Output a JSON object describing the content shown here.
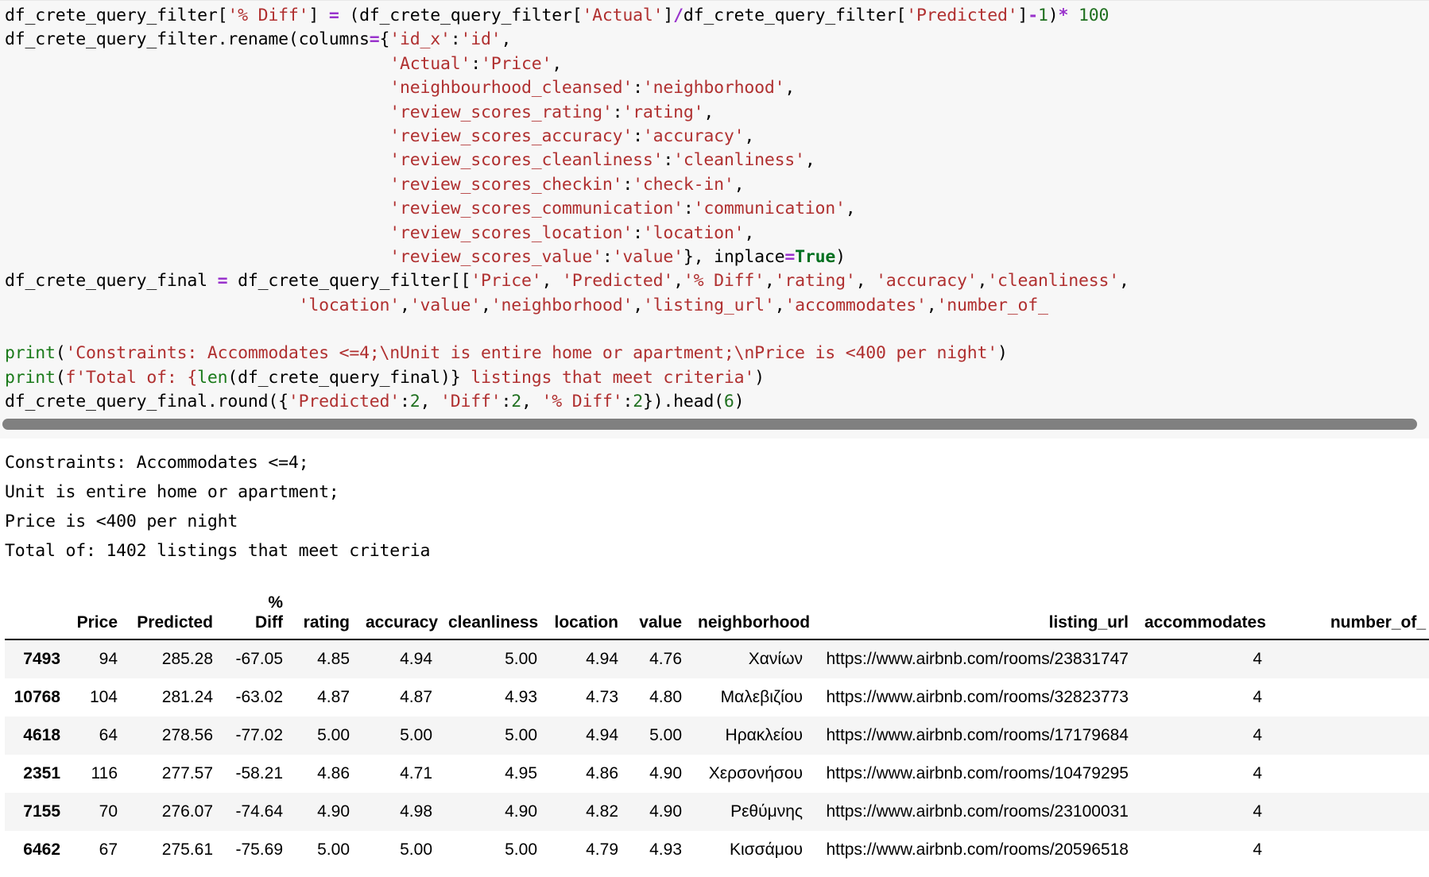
{
  "code_cell": {
    "lines": [
      [
        {
          "t": "df_crete_query_filter[",
          "c": "plain"
        },
        {
          "t": "'% Diff'",
          "c": "str"
        },
        {
          "t": "] ",
          "c": "plain"
        },
        {
          "t": "=",
          "c": "op"
        },
        {
          "t": " (df_crete_query_filter[",
          "c": "plain"
        },
        {
          "t": "'Actual'",
          "c": "str"
        },
        {
          "t": "]",
          "c": "plain"
        },
        {
          "t": "/",
          "c": "op"
        },
        {
          "t": "df_crete_query_filter[",
          "c": "plain"
        },
        {
          "t": "'Predicted'",
          "c": "str"
        },
        {
          "t": "]",
          "c": "plain"
        },
        {
          "t": "-",
          "c": "op"
        },
        {
          "t": "1",
          "c": "num"
        },
        {
          "t": ")",
          "c": "plain"
        },
        {
          "t": "*",
          "c": "op"
        },
        {
          "t": " ",
          "c": "plain"
        },
        {
          "t": "100",
          "c": "num"
        }
      ],
      [
        {
          "t": "df_crete_query_filter.rename(columns",
          "c": "plain"
        },
        {
          "t": "=",
          "c": "op"
        },
        {
          "t": "{",
          "c": "plain"
        },
        {
          "t": "'id_x'",
          "c": "str"
        },
        {
          "t": ":",
          "c": "plain"
        },
        {
          "t": "'id'",
          "c": "str"
        },
        {
          "t": ",",
          "c": "plain"
        }
      ],
      [
        {
          "t": "                                      ",
          "c": "plain"
        },
        {
          "t": "'Actual'",
          "c": "str"
        },
        {
          "t": ":",
          "c": "plain"
        },
        {
          "t": "'Price'",
          "c": "str"
        },
        {
          "t": ",",
          "c": "plain"
        }
      ],
      [
        {
          "t": "                                      ",
          "c": "plain"
        },
        {
          "t": "'neighbourhood_cleansed'",
          "c": "str"
        },
        {
          "t": ":",
          "c": "plain"
        },
        {
          "t": "'neighborhood'",
          "c": "str"
        },
        {
          "t": ",",
          "c": "plain"
        }
      ],
      [
        {
          "t": "                                      ",
          "c": "plain"
        },
        {
          "t": "'review_scores_rating'",
          "c": "str"
        },
        {
          "t": ":",
          "c": "plain"
        },
        {
          "t": "'rating'",
          "c": "str"
        },
        {
          "t": ",",
          "c": "plain"
        }
      ],
      [
        {
          "t": "                                      ",
          "c": "plain"
        },
        {
          "t": "'review_scores_accuracy'",
          "c": "str"
        },
        {
          "t": ":",
          "c": "plain"
        },
        {
          "t": "'accuracy'",
          "c": "str"
        },
        {
          "t": ",",
          "c": "plain"
        }
      ],
      [
        {
          "t": "                                      ",
          "c": "plain"
        },
        {
          "t": "'review_scores_cleanliness'",
          "c": "str"
        },
        {
          "t": ":",
          "c": "plain"
        },
        {
          "t": "'cleanliness'",
          "c": "str"
        },
        {
          "t": ",",
          "c": "plain"
        }
      ],
      [
        {
          "t": "                                      ",
          "c": "plain"
        },
        {
          "t": "'review_scores_checkin'",
          "c": "str"
        },
        {
          "t": ":",
          "c": "plain"
        },
        {
          "t": "'check-in'",
          "c": "str"
        },
        {
          "t": ",",
          "c": "plain"
        }
      ],
      [
        {
          "t": "                                      ",
          "c": "plain"
        },
        {
          "t": "'review_scores_communication'",
          "c": "str"
        },
        {
          "t": ":",
          "c": "plain"
        },
        {
          "t": "'communication'",
          "c": "str"
        },
        {
          "t": ",",
          "c": "plain"
        }
      ],
      [
        {
          "t": "                                      ",
          "c": "plain"
        },
        {
          "t": "'review_scores_location'",
          "c": "str"
        },
        {
          "t": ":",
          "c": "plain"
        },
        {
          "t": "'location'",
          "c": "str"
        },
        {
          "t": ",",
          "c": "plain"
        }
      ],
      [
        {
          "t": "                                      ",
          "c": "plain"
        },
        {
          "t": "'review_scores_value'",
          "c": "str"
        },
        {
          "t": ":",
          "c": "plain"
        },
        {
          "t": "'value'",
          "c": "str"
        },
        {
          "t": "}, inplace",
          "c": "plain"
        },
        {
          "t": "=",
          "c": "op"
        },
        {
          "t": "True",
          "c": "kw"
        },
        {
          "t": ")",
          "c": "plain"
        }
      ],
      [
        {
          "t": "df_crete_query_final ",
          "c": "plain"
        },
        {
          "t": "=",
          "c": "op"
        },
        {
          "t": " df_crete_query_filter[[",
          "c": "plain"
        },
        {
          "t": "'Price'",
          "c": "str"
        },
        {
          "t": ", ",
          "c": "plain"
        },
        {
          "t": "'Predicted'",
          "c": "str"
        },
        {
          "t": ",",
          "c": "plain"
        },
        {
          "t": "'% Diff'",
          "c": "str"
        },
        {
          "t": ",",
          "c": "plain"
        },
        {
          "t": "'rating'",
          "c": "str"
        },
        {
          "t": ", ",
          "c": "plain"
        },
        {
          "t": "'accuracy'",
          "c": "str"
        },
        {
          "t": ",",
          "c": "plain"
        },
        {
          "t": "'cleanliness'",
          "c": "str"
        },
        {
          "t": ",",
          "c": "plain"
        }
      ],
      [
        {
          "t": "                             ",
          "c": "plain"
        },
        {
          "t": "'location'",
          "c": "str"
        },
        {
          "t": ",",
          "c": "plain"
        },
        {
          "t": "'value'",
          "c": "str"
        },
        {
          "t": ",",
          "c": "plain"
        },
        {
          "t": "'neighborhood'",
          "c": "str"
        },
        {
          "t": ",",
          "c": "plain"
        },
        {
          "t": "'listing_url'",
          "c": "str"
        },
        {
          "t": ",",
          "c": "plain"
        },
        {
          "t": "'accommodates'",
          "c": "str"
        },
        {
          "t": ",",
          "c": "plain"
        },
        {
          "t": "'number_of_",
          "c": "str"
        }
      ],
      [],
      [
        {
          "t": "print",
          "c": "fn"
        },
        {
          "t": "(",
          "c": "plain"
        },
        {
          "t": "'Constraints: Accommodates <=4;\\nUnit is entire home or apartment;\\nPrice is <400 per night'",
          "c": "str"
        },
        {
          "t": ")",
          "c": "plain"
        }
      ],
      [
        {
          "t": "print",
          "c": "fn"
        },
        {
          "t": "(",
          "c": "plain"
        },
        {
          "t": "f'Total of: {",
          "c": "str"
        },
        {
          "t": "len",
          "c": "fn"
        },
        {
          "t": "(df_crete_query_final)} ",
          "c": "plain"
        },
        {
          "t": "listings that meet criteria'",
          "c": "str"
        },
        {
          "t": ")",
          "c": "plain"
        }
      ],
      [
        {
          "t": "df_crete_query_final.round({",
          "c": "plain"
        },
        {
          "t": "'Predicted'",
          "c": "str"
        },
        {
          "t": ":",
          "c": "plain"
        },
        {
          "t": "2",
          "c": "num"
        },
        {
          "t": ", ",
          "c": "plain"
        },
        {
          "t": "'Diff'",
          "c": "str"
        },
        {
          "t": ":",
          "c": "plain"
        },
        {
          "t": "2",
          "c": "num"
        },
        {
          "t": ", ",
          "c": "plain"
        },
        {
          "t": "'% Diff'",
          "c": "str"
        },
        {
          "t": ":",
          "c": "plain"
        },
        {
          "t": "2",
          "c": "num"
        },
        {
          "t": "}).head(",
          "c": "plain"
        },
        {
          "t": "6",
          "c": "num"
        },
        {
          "t": ")",
          "c": "plain"
        }
      ]
    ],
    "scrollbar": {
      "orientation": "horizontal"
    }
  },
  "stdout": "Constraints: Accommodates <=4;\nUnit is entire home or apartment;\nPrice is <400 per night\nTotal of: 1402 listings that meet criteria",
  "table_data": {
    "type": "table",
    "index_header": "",
    "columns": [
      "Price",
      "Predicted",
      "%\nDiff",
      "rating",
      "accuracy",
      "cleanliness",
      "location",
      "value",
      "neighborhood",
      "listing_url",
      "accommodates",
      "number_of_"
    ],
    "index": [
      "7493",
      "10768",
      "4618",
      "2351",
      "7155",
      "6462"
    ],
    "rows": [
      [
        "94",
        "285.28",
        "-67.05",
        "4.85",
        "4.94",
        "5.00",
        "4.94",
        "4.76",
        "Χανίων",
        "https://www.airbnb.com/rooms/23831747",
        "4",
        ""
      ],
      [
        "104",
        "281.24",
        "-63.02",
        "4.87",
        "4.87",
        "4.93",
        "4.73",
        "4.80",
        "Μαλεβιζίου",
        "https://www.airbnb.com/rooms/32823773",
        "4",
        ""
      ],
      [
        "64",
        "278.56",
        "-77.02",
        "5.00",
        "5.00",
        "5.00",
        "4.94",
        "5.00",
        "Ηρακλείου",
        "https://www.airbnb.com/rooms/17179684",
        "4",
        ""
      ],
      [
        "116",
        "277.57",
        "-58.21",
        "4.86",
        "4.71",
        "4.95",
        "4.86",
        "4.90",
        "Χερσονήσου",
        "https://www.airbnb.com/rooms/10479295",
        "4",
        ""
      ],
      [
        "70",
        "276.07",
        "-74.64",
        "4.90",
        "4.98",
        "4.90",
        "4.82",
        "4.90",
        "Ρεθύμνης",
        "https://www.airbnb.com/rooms/23100031",
        "4",
        ""
      ],
      [
        "67",
        "275.61",
        "-75.69",
        "5.00",
        "5.00",
        "5.00",
        "4.79",
        "4.93",
        "Κισσάμου",
        "https://www.airbnb.com/rooms/20596518",
        "4",
        ""
      ]
    ]
  },
  "colors": {
    "string": "#b03030",
    "operator": "#9933cc",
    "number": "#207020",
    "keyword": "#007020",
    "function": "#1a7a1a",
    "cell_background": "#f7f7f7",
    "scrollbar_thumb": "#808080",
    "row_stripe": "#f5f5f5"
  }
}
